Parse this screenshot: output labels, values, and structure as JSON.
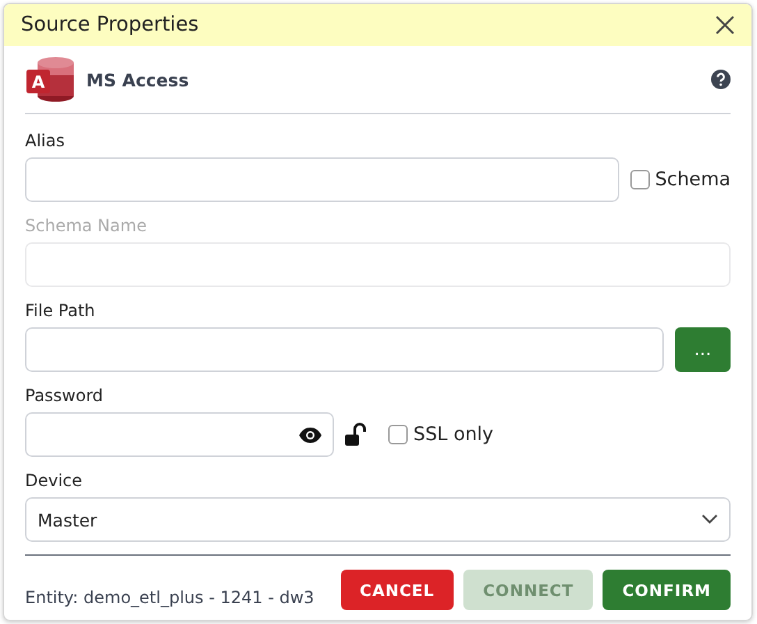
{
  "window": {
    "title": "Source Properties"
  },
  "source": {
    "name": "MS Access",
    "logo_letter": "A"
  },
  "fields": [
    {
      "kind": "text",
      "label": "Alias",
      "disabled": false,
      "checkbox": {
        "label": "Schema",
        "checked": false
      }
    },
    {
      "kind": "text",
      "label": "Schema Name",
      "disabled": true
    },
    {
      "kind": "browse",
      "label": "File Path",
      "disabled": false,
      "button": "..."
    },
    {
      "kind": "password",
      "label": "Password",
      "disabled": false,
      "locked": false,
      "checkbox": {
        "label": "SSL only",
        "checked": false
      }
    },
    {
      "kind": "select",
      "label": "Device",
      "disabled": false,
      "value": "Master"
    }
  ],
  "footer": {
    "entity": "Entity: demo_etl_plus - 1241 - dw3",
    "buttons": [
      {
        "label": "CANCEL",
        "kind": "danger",
        "disabled": false
      },
      {
        "label": "CONNECT",
        "kind": "primary",
        "disabled": true
      },
      {
        "label": "CONFIRM",
        "kind": "primary",
        "disabled": false
      }
    ]
  }
}
